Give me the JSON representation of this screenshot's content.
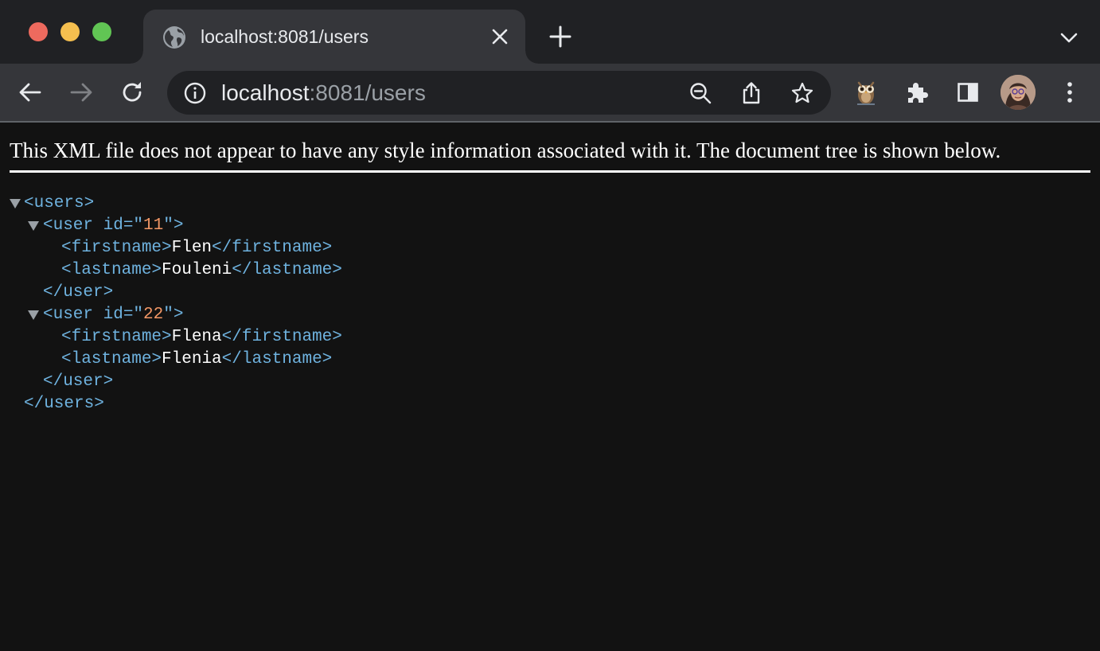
{
  "browser": {
    "tab": {
      "title": "localhost:8081/users",
      "favicon": "globe-icon"
    },
    "address_bar": {
      "host": "localhost",
      "path": ":8081/users"
    },
    "toolbar_icons": [
      "back-arrow-icon",
      "forward-arrow-icon",
      "reload-icon",
      "info-icon",
      "zoom-out-icon",
      "share-icon",
      "star-icon",
      "owl-extension-icon",
      "puzzle-icon",
      "side-panel-icon",
      "profile-avatar",
      "kebab-menu-icon"
    ]
  },
  "page": {
    "notice": "This XML file does not appear to have any style information associated with it. The document tree is shown below.",
    "root_open": "<users>",
    "root_close": "</users>",
    "users": [
      {
        "open_prefix": "<user id=\"",
        "id": "11",
        "open_suffix": "\">",
        "firstname_open": "<firstname>",
        "firstname": "Flen",
        "firstname_close": "</firstname>",
        "lastname_open": "<lastname>",
        "lastname": "Fouleni",
        "lastname_close": "</lastname>",
        "close": "</user>"
      },
      {
        "open_prefix": "<user id=\"",
        "id": "22",
        "open_suffix": "\">",
        "firstname_open": "<firstname>",
        "firstname": "Flena",
        "firstname_close": "</firstname>",
        "lastname_open": "<lastname>",
        "lastname": "Flenia",
        "lastname_close": "</lastname>",
        "close": "</user>"
      }
    ]
  },
  "colors": {
    "tag": "#6fb3e0",
    "attribute_value": "#f29766",
    "text": "#ffffff",
    "background": "#121212"
  }
}
